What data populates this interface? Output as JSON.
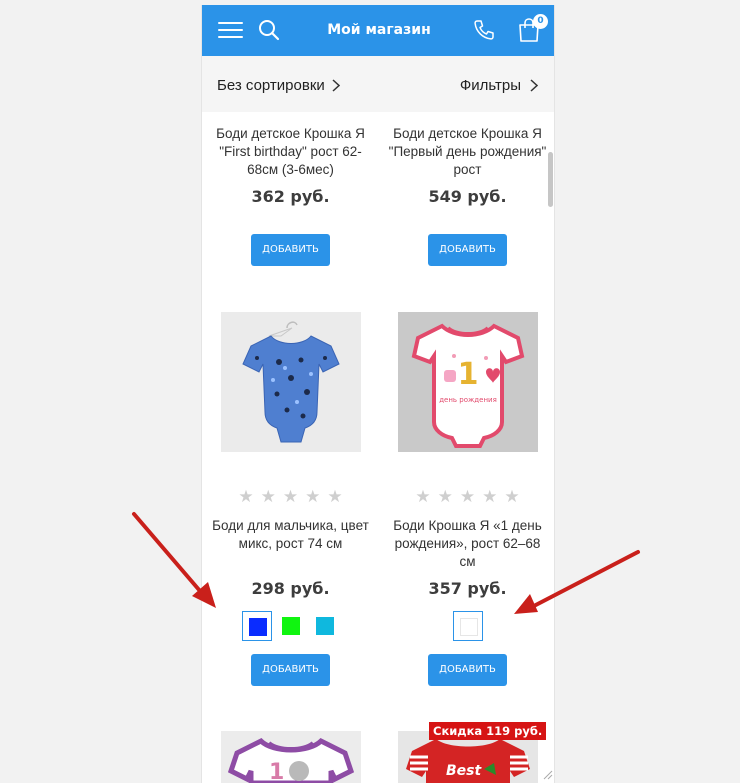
{
  "header": {
    "title": "Мой магазин",
    "cart_count": "0"
  },
  "toolbar": {
    "sort_label": "Без сортировки",
    "filter_label": "Фильтры"
  },
  "products": [
    {
      "name": "Боди детское Крошка Я \"First birthday\" рост 62-68см (3-6мес)",
      "price": "362 руб.",
      "add_label": "ДОБАВИТЬ"
    },
    {
      "name": "Боди детское Крошка Я \"Первый день рождения\" рост",
      "price": "549 руб.",
      "add_label": "ДОБАВИТЬ"
    },
    {
      "name": "Боди для мальчика, цвет микс, рост 74 см",
      "price": "298 руб.",
      "add_label": "ДОБАВИТЬ",
      "rating": 0,
      "rating_max": 5,
      "colors": [
        "#0a2cff",
        "#10f510",
        "#0fb8de"
      ],
      "selected_color": 0
    },
    {
      "name": "Боди Крошка Я «1 день рождения», рост 62–68 см",
      "price": "357 руб.",
      "add_label": "ДОБАВИТЬ",
      "rating": 0,
      "rating_max": 5,
      "colors": [
        "#ffffff"
      ],
      "selected_color": 0,
      "print_text": "1",
      "print_caption": "день рождения"
    },
    {
      "print_text": "1"
    },
    {
      "discount_label": "Скидка 119 руб.",
      "print_text": "Best"
    }
  ],
  "colors": {
    "accent": "#2b93e8",
    "discount": "#d61414",
    "annotation_arrow": "#c9201b"
  }
}
